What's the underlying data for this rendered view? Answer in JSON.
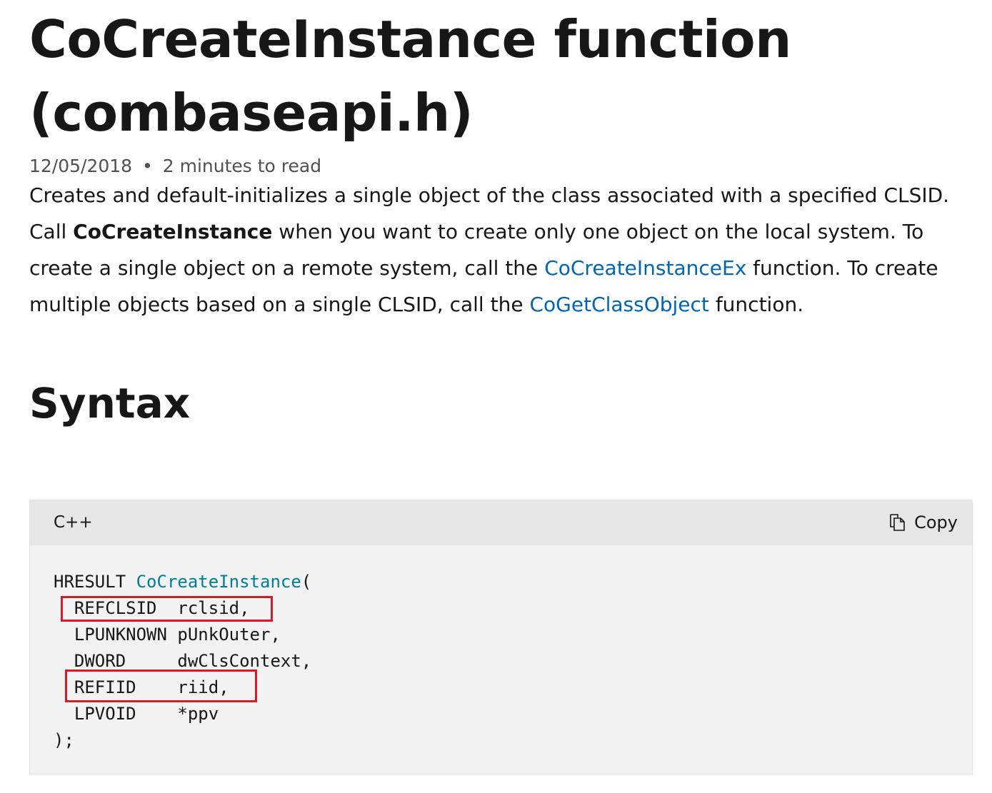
{
  "article": {
    "title": "CoCreateInstance function (combaseapi.h)",
    "date": "12/05/2018",
    "separator": "•",
    "read_time": "2 minutes to read",
    "summary": "Creates and default-initializes a single object of the class associated with a specified CLSID.",
    "para2": {
      "t1": "Call ",
      "bold": "CoCreateInstance",
      "t2": " when you want to create only one object on the local system. To create a single object on a remote system, call the ",
      "link1": "CoCreateInstanceEx",
      "t3": " function. To create multiple objects based on a single CLSID, call the ",
      "link2": "CoGetClassObject",
      "t4": " function."
    },
    "syntax_heading": "Syntax"
  },
  "code": {
    "language": "C++",
    "copy_label": "Copy",
    "return_type": "HRESULT",
    "function_name": "CoCreateInstance",
    "open_paren": "(",
    "params": [
      {
        "type": "REFCLSID ",
        "name": "rclsid,",
        "highlighted": true
      },
      {
        "type": "LPUNKNOWN",
        "name": "pUnkOuter,",
        "highlighted": false
      },
      {
        "type": "DWORD    ",
        "name": "dwClsContext,",
        "highlighted": false
      },
      {
        "type": "REFIID   ",
        "name": "riid,",
        "highlighted": true
      },
      {
        "type": "LPVOID   ",
        "name": "*ppv",
        "highlighted": false
      }
    ],
    "close": ");"
  },
  "colors": {
    "link": "#0065b3",
    "code_function": "#007d9a",
    "highlight_box": "#d71a28",
    "code_bg": "#f2f2f2",
    "code_header_bg": "#e6e6e6"
  }
}
